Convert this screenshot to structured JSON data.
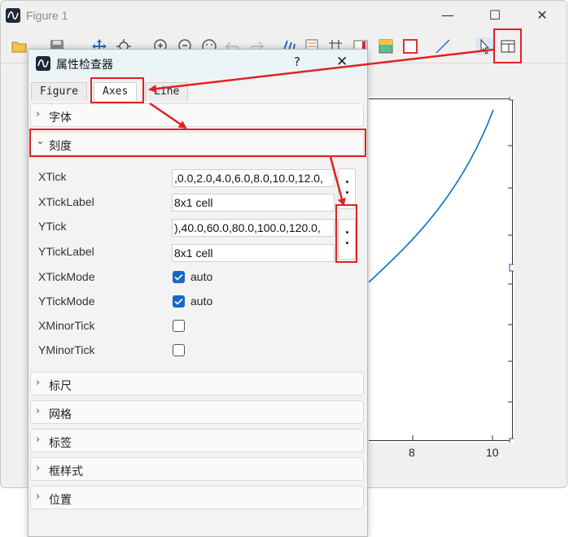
{
  "window": {
    "title": "Figure 1",
    "controls": {
      "minimize": "—",
      "maximize": "☐",
      "close": "✕"
    }
  },
  "toolbar": {
    "items": [
      "open-icon",
      "save-icon",
      "pan-icon",
      "datatip-icon",
      "zoom-in-icon",
      "zoom-out-icon",
      "reset-view-icon",
      "undo-icon",
      "redo-icon",
      "brush-icon",
      "insert-legend-icon",
      "grid-icon",
      "insert-colorbar-icon",
      "colormap-icon",
      "box-icon",
      "line-icon",
      "select-pointer-icon",
      "property-inspector-icon"
    ]
  },
  "axes": {
    "x_tick_labels": [
      "8",
      "10"
    ],
    "line_color": "#0072bd"
  },
  "dialog": {
    "title": "属性检查器",
    "help": "?",
    "close": "✕",
    "tabs": [
      "Figure",
      "Axes",
      "Line"
    ],
    "active_tab": "Axes",
    "sections_top": [
      {
        "label": "字体",
        "expanded": false
      },
      {
        "label": "刻度",
        "expanded": true
      }
    ],
    "properties": {
      "xtick": {
        "label": "XTick",
        "value": ",0.0,2.0,4.0,6.0,8.0,10.0,12.0,"
      },
      "xticklabel": {
        "label": "XTickLabel",
        "value": "8x1 cell"
      },
      "ytick": {
        "label": "YTick",
        "value": "),40.0,60.0,80.0,100.0,120.0,"
      },
      "yticklabel": {
        "label": "YTickLabel",
        "value": "8x1 cell"
      },
      "xtickmode": {
        "label": "XTickMode",
        "checked": true,
        "text": "auto"
      },
      "ytickmode": {
        "label": "YTickMode",
        "checked": true,
        "text": "auto"
      },
      "xminortick": {
        "label": "XMinorTick",
        "checked": false
      },
      "yminortick": {
        "label": "YMinorTick",
        "checked": false
      }
    },
    "sections_bottom": [
      {
        "label": "标尺"
      },
      {
        "label": "网格"
      },
      {
        "label": "标签"
      },
      {
        "label": "框样式"
      },
      {
        "label": "位置"
      }
    ]
  },
  "annotation_color": "#e02222",
  "accent_color": "#1a66c8"
}
